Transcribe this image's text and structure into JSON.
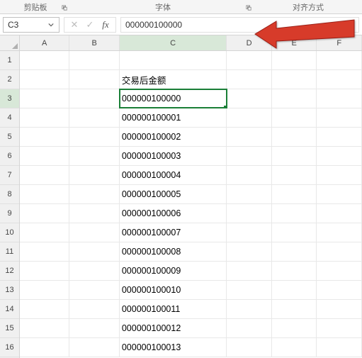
{
  "ribbon": {
    "section1": "剪贴板",
    "section2": "字体",
    "section3": "对齐方式"
  },
  "nameBox": {
    "value": "C3"
  },
  "formulaBar": {
    "value": "000000100000"
  },
  "columns": [
    "A",
    "B",
    "C",
    "D",
    "E",
    "F"
  ],
  "rows": [
    "1",
    "2",
    "3",
    "4",
    "5",
    "6",
    "7",
    "8",
    "9",
    "10",
    "11",
    "12",
    "13",
    "14",
    "15",
    "16"
  ],
  "activeCell": {
    "row": 3,
    "col": "C"
  },
  "data": {
    "C2": "交易后金额",
    "C3": "000000100000",
    "C4": "000000100001",
    "C5": "000000100002",
    "C6": "000000100003",
    "C7": "000000100004",
    "C8": "000000100005",
    "C9": "000000100006",
    "C10": "000000100007",
    "C11": "000000100008",
    "C12": "000000100009",
    "C13": "000000100010",
    "C14": "000000100011",
    "C15": "000000100012",
    "C16": "000000100013"
  },
  "chart_data": null
}
